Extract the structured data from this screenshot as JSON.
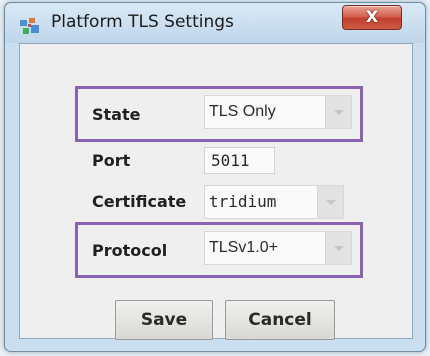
{
  "window": {
    "title": "Platform TLS Settings",
    "close_symbol": "X"
  },
  "form": {
    "state": {
      "label": "State",
      "value": "TLS Only"
    },
    "port": {
      "label": "Port",
      "value": "5011"
    },
    "certificate": {
      "label": "Certificate",
      "value": "tridium"
    },
    "protocol": {
      "label": "Protocol",
      "value": "TLSv1.0+"
    }
  },
  "buttons": {
    "save": "Save",
    "cancel": "Cancel"
  },
  "colors": {
    "highlight": "#8a63b3",
    "close_button": "#c1412d"
  }
}
